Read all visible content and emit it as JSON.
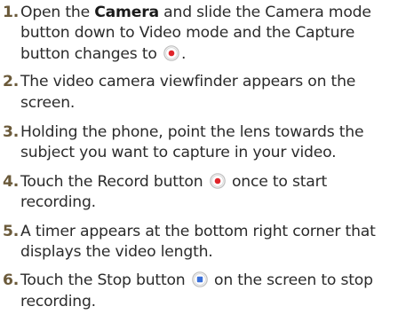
{
  "steps": [
    {
      "num": "1.",
      "pre": "Open the ",
      "bold": "Camera",
      "post": " and slide the Camera mode button down to Video mode and the Capture button changes to",
      "icon": "record-button-icon",
      "end": "."
    },
    {
      "num": "2.",
      "text": "The video camera viewfinder appears on the screen."
    },
    {
      "num": "3.",
      "text": "Holding the phone, point the lens towards the subject you want to capture in your video."
    },
    {
      "num": "4.",
      "pre": "Touch the Record button",
      "icon": "record-button-icon",
      "post": "once to start recording."
    },
    {
      "num": "5.",
      "text": "A timer appears at the bottom right corner that displays the video length."
    },
    {
      "num": "6.",
      "pre": "Touch the Stop button",
      "icon": "stop-button-icon",
      "post": "on the screen to stop recording."
    }
  ],
  "colors": {
    "text": "#2b2b2b",
    "number": "#6b5a3a",
    "record_dot": "#e0252b",
    "stop_square": "#3a6fd8",
    "icon_ring": "#bfbfbf"
  }
}
